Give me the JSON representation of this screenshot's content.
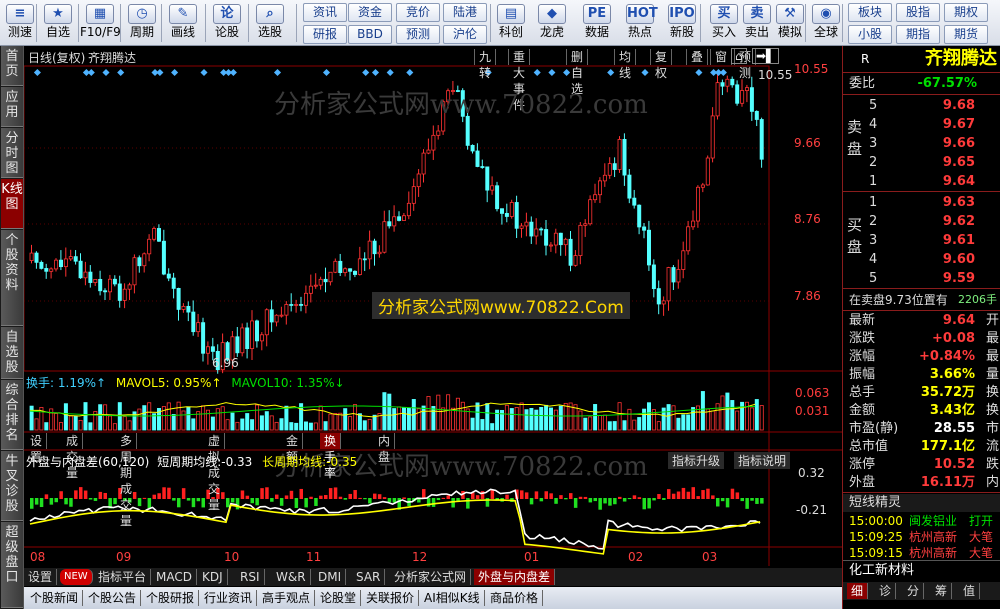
{
  "toolbar": {
    "buttons": [
      {
        "label": "测速",
        "icon": "speed-test-icon",
        "glyph": "≡"
      },
      {
        "label": "自选",
        "icon": "star-icon",
        "glyph": "★"
      },
      {
        "label": "F10/F9",
        "icon": "f10-icon",
        "glyph": "▦"
      },
      {
        "label": "周期",
        "icon": "clock-icon",
        "glyph": "◷"
      },
      {
        "label": "画线",
        "icon": "pencil-icon",
        "glyph": "✎"
      },
      {
        "label": "论股",
        "icon": "discuss-icon",
        "glyph": "论"
      },
      {
        "label": "选股",
        "icon": "magnifier-icon",
        "glyph": "⌕"
      },
      {
        "label": "科创",
        "icon": "kechuang-icon",
        "glyph": "▤"
      },
      {
        "label": "龙虎",
        "icon": "dragon-tiger-icon",
        "glyph": "◆"
      },
      {
        "label": "数据",
        "icon": "pe-icon",
        "glyph": "PE"
      },
      {
        "label": "热点",
        "icon": "hot-icon",
        "glyph": "HOT"
      },
      {
        "label": "新股",
        "icon": "ipo-icon",
        "glyph": "IPO"
      },
      {
        "label": "买入",
        "icon": "buy-icon",
        "glyph": "买"
      },
      {
        "label": "卖出",
        "icon": "sell-icon",
        "glyph": "卖"
      },
      {
        "label": "模拟",
        "icon": "hammer-icon",
        "glyph": "⚒"
      },
      {
        "label": "全球",
        "icon": "globe-icon",
        "glyph": "◉"
      }
    ],
    "small_buttons": [
      "资讯",
      "资金",
      "竞价",
      "陆港",
      "研报",
      "BBD",
      "预测",
      "沪伦",
      "板块",
      "股指",
      "期权",
      "小股",
      "期指",
      "期货"
    ]
  },
  "sidebar": [
    "首页",
    "应用",
    "分时图",
    "K线图",
    "个股资料",
    "自选股",
    "综合排名",
    "牛叉诊股",
    "超级盘口"
  ],
  "chart": {
    "title": "日线(复权)",
    "stock_name": "齐翔腾达",
    "top_buttons": [
      "九转",
      "重大事件",
      "删自选",
      "均线",
      "复权",
      "叠",
      "窗",
      "预测"
    ],
    "price_axis": [
      "10.55",
      "9.66",
      "8.76",
      "7.86"
    ],
    "high_label": "10.55",
    "low_label": "6.96",
    "watermark1": "分析家公式网www.70822.com",
    "watermark2": "分析家公式网www.70822.Com",
    "vol_title_label": "换手:",
    "vol_title_value": "1.19%↑",
    "ma5_label": "MAVOL5:",
    "ma5_value": "0.95%↑",
    "ma10_label": "MAVOL10:",
    "ma10_value": "1.35%↓",
    "vol_axis": [
      "0.063",
      "0.031"
    ],
    "mid_tabs": [
      "设置",
      "成交量",
      "多周期成交量",
      "虚拟成交量",
      "金额",
      "换手率",
      "内盘"
    ],
    "ind_title": "外盘与内盘差(60,120)",
    "ind_short_label": "短周期均线:",
    "ind_short_value": "-0.33",
    "ind_long_label": "长周期均线:",
    "ind_long_value": "-0.35",
    "ind_upgrade": "指标升级",
    "ind_help": "指标说明",
    "ind_axis": [
      "0.32",
      "-0.21"
    ],
    "date_axis": [
      "08",
      "09",
      "10",
      "11",
      "12",
      "01",
      "02",
      "03"
    ],
    "bottom_tabs": [
      "设置",
      "NEW",
      "指标平台",
      "MACD",
      "KDJ",
      "RSI",
      "W&R",
      "DMI",
      "SAR",
      "分析家公式网",
      "外盘与内盘差"
    ],
    "bottom_tabs2": [
      "个股新闻",
      "个股公告",
      "个股研报",
      "行业资讯",
      "高手观点",
      "论股堂",
      "关联报价",
      "AI相似K线",
      "商品价格"
    ],
    "colors": {
      "up": "#ff3232",
      "down": "#54ffff",
      "axis": "#8b0000",
      "white_line": "#ffffff",
      "yellow_line": "#ffff00",
      "signal": "#4fb3ff"
    }
  },
  "right_panel": {
    "marker": "R",
    "name": "齐翔腾达",
    "webi_label": "委比",
    "webi_value": "-67.57%",
    "sell_label": "卖盘",
    "buy_label": "买盘",
    "asks": [
      {
        "lvl": "5",
        "price": "9.68"
      },
      {
        "lvl": "4",
        "price": "9.67"
      },
      {
        "lvl": "3",
        "price": "9.66"
      },
      {
        "lvl": "2",
        "price": "9.65"
      },
      {
        "lvl": "1",
        "price": "9.64"
      }
    ],
    "bids": [
      {
        "lvl": "1",
        "price": "9.63"
      },
      {
        "lvl": "2",
        "price": "9.62"
      },
      {
        "lvl": "3",
        "price": "9.61"
      },
      {
        "lvl": "4",
        "price": "9.60"
      },
      {
        "lvl": "5",
        "price": "9.59"
      }
    ],
    "order_note": "在卖盘9.73位置有",
    "order_qty": "2206手",
    "stats": [
      {
        "label": "最新",
        "value": "9.64",
        "tail": "开",
        "cls": "red"
      },
      {
        "label": "涨跌",
        "value": "+0.08",
        "tail": "最",
        "cls": "red"
      },
      {
        "label": "涨幅",
        "value": "+0.84%",
        "tail": "最",
        "cls": "red"
      },
      {
        "label": "振幅",
        "value": "3.66%",
        "tail": "量",
        "cls": "yel"
      },
      {
        "label": "总手",
        "value": "35.72万",
        "tail": "换",
        "cls": "yel"
      },
      {
        "label": "金额",
        "value": "3.43亿",
        "tail": "换",
        "cls": "yel"
      },
      {
        "label": "市盈(静)",
        "value": "28.55",
        "tail": "市",
        "cls": "white"
      },
      {
        "label": "总市值",
        "value": "177.1亿",
        "tail": "流",
        "cls": "yel"
      },
      {
        "label": "涨停",
        "value": "10.52",
        "tail": "跌",
        "cls": "red"
      },
      {
        "label": "外盘",
        "value": "16.11万",
        "tail": "内",
        "cls": "red"
      }
    ],
    "sprite_title": "短线精灵",
    "sprite_rows": [
      {
        "time": "15:00:00",
        "name": "闽发铝业",
        "act": "打开"
      },
      {
        "time": "15:09:25",
        "name": "杭州高新",
        "act": "大笔"
      },
      {
        "time": "15:09:15",
        "name": "杭州高新",
        "act": "大笔"
      }
    ],
    "sprite_footer": "化工新材料",
    "bottom_tabs": [
      "细",
      "诊",
      "分",
      "筹",
      "值"
    ]
  }
}
